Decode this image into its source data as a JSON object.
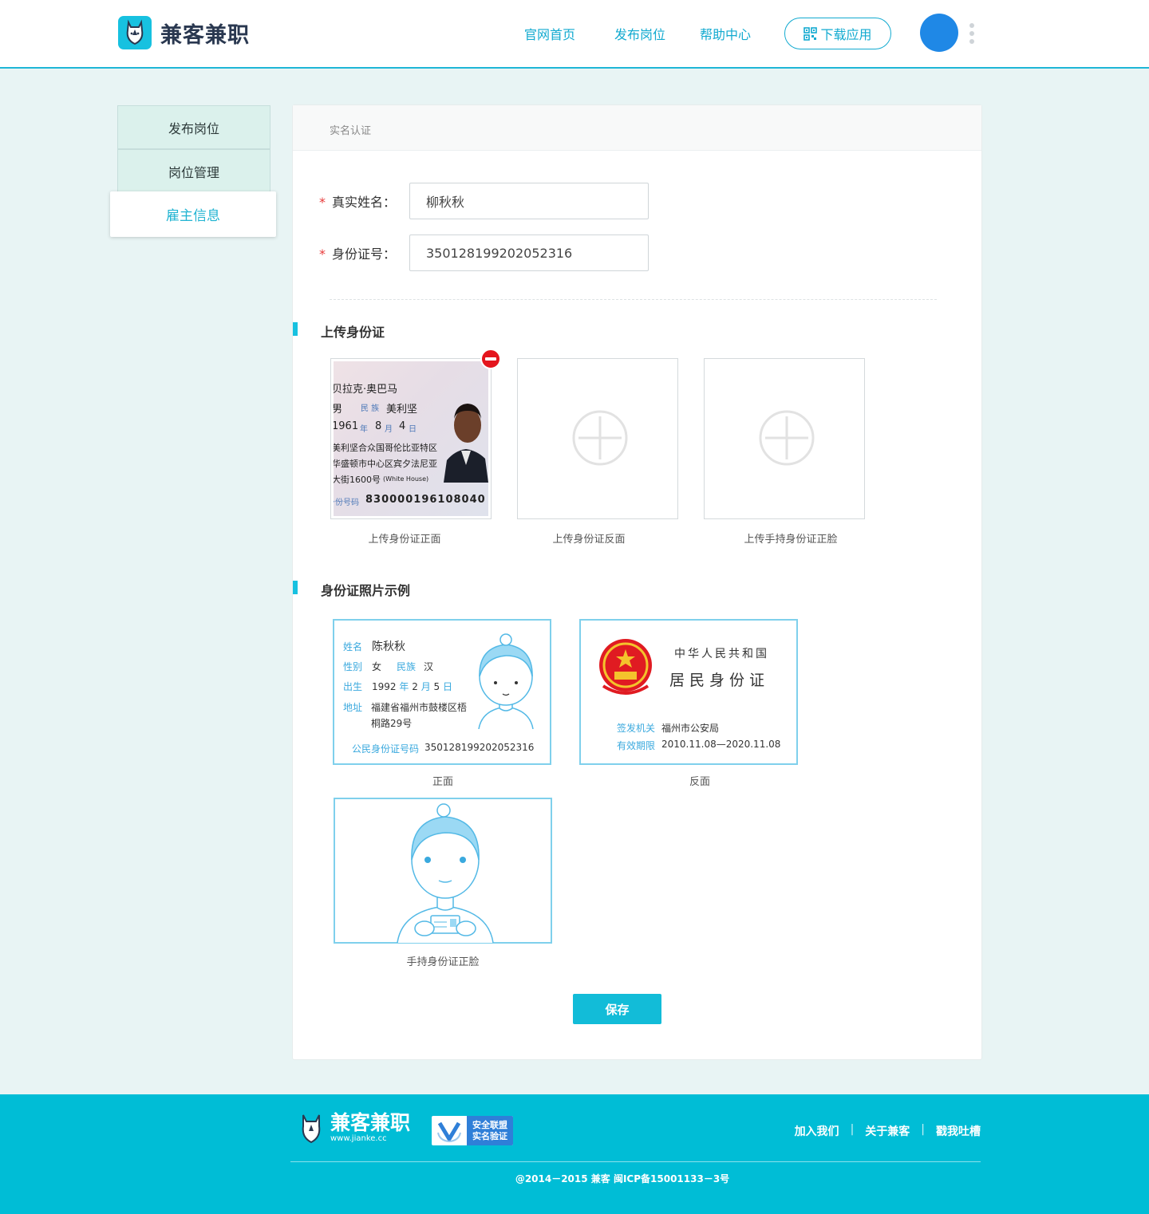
{
  "header": {
    "brand": "兼客兼职",
    "nav": [
      "官网首页",
      "发布岗位",
      "帮助中心"
    ],
    "download_label": "下载应用",
    "accent_color": "#12aad0",
    "icons": {
      "logo": "rhino-logo-icon",
      "qr": "qr-code-icon",
      "more": "more-vertical-icon"
    }
  },
  "sidebar": {
    "items": [
      {
        "label": "发布岗位",
        "active": false
      },
      {
        "label": "岗位管理",
        "active": false
      },
      {
        "label": "雇主信息",
        "active": true
      }
    ]
  },
  "panel": {
    "title": "实名认证",
    "fields": {
      "name_label": "真实姓名：",
      "name_value": "柳秋秋",
      "id_label": "身份证号：",
      "id_value": "350128199202052316",
      "required_mark": "*"
    },
    "upload": {
      "section_title": "上传身份证",
      "boxes": [
        {
          "caption": "上传身份证正面",
          "filled": true
        },
        {
          "caption": "上传身份证反面",
          "filled": false
        },
        {
          "caption": "上传手持身份证正脸",
          "filled": false
        }
      ],
      "uploaded_card": {
        "name": "贝拉克·奥巴马",
        "ethnicity_label": "民 族",
        "ethnicity": "美利坚",
        "gender": "男",
        "birth_year": "1961",
        "year_label": "年",
        "birth_month": "8",
        "month_label": "月",
        "birth_day": "4",
        "day_label": "日",
        "address_1": "美利坚合众国哥伦比亚特区",
        "address_2": "华盛顿市中心区宾夕法尼亚",
        "address_3": "大街1600号",
        "address_note": "(White House)",
        "id_label": "身份号码",
        "id_number": "830000196108040"
      }
    },
    "samples": {
      "section_title": "身份证照片示例",
      "front": {
        "caption": "正面",
        "name_key": "姓名",
        "name": "陈秋秋",
        "gender_key": "性别",
        "gender": "女",
        "ethnicity_key": "民族",
        "ethnicity": "汉",
        "birth_key": "出生",
        "year": "1992",
        "year_unit": "年",
        "month": "2",
        "month_unit": "月",
        "day": "5",
        "day_unit": "日",
        "address_key": "地址",
        "address_1": "福建省福州市鼓楼区梧",
        "address_2": "桐路29号",
        "id_key": "公民身份证号码",
        "id_number": "350128199202052316"
      },
      "back": {
        "caption": "反面",
        "country": "中华人民共和国",
        "doc": "居民身份证",
        "issuer_key": "签发机关",
        "issuer": "福州市公安局",
        "validity_key": "有效期限",
        "validity": "2010.11.08—2020.11.08"
      },
      "hold": {
        "caption": "手持身份证正脸"
      }
    },
    "save_label": "保存"
  },
  "footer": {
    "brand": "兼客兼职",
    "url": "www.jianke.cc",
    "badge_1": "安全联盟",
    "badge_2": "实名验证",
    "links": [
      "加入我们",
      "关于兼客",
      "戳我吐槽"
    ],
    "copyright": "@2014－2015 兼客 闽ICP备15001133－3号",
    "bg_color": "#00bdd6"
  }
}
